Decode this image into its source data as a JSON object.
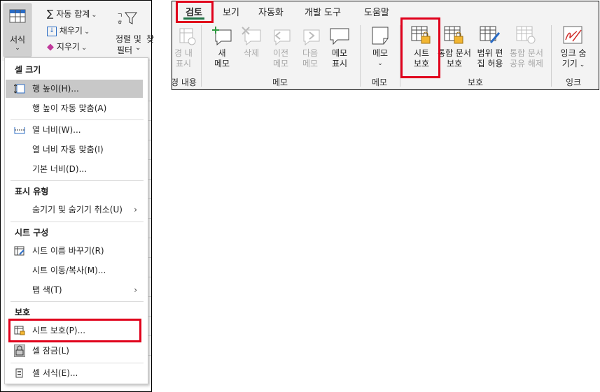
{
  "left_ribbon": {
    "format_button": "서식",
    "autosum": "자동 합계",
    "fill": "채우기",
    "clear": "지우기",
    "sort_filter_line1": "정렬 및",
    "sort_filter_line2": "필터",
    "find_fragment": "찾"
  },
  "format_menu": {
    "sections": {
      "cell_size": "셀 크기",
      "visibility": "표시 유형",
      "organize_sheets": "시트 구성",
      "protection": "보호"
    },
    "items": {
      "row_height": "행 높이(H)...",
      "autofit_row": "행 높이 자동 맞춤(A)",
      "col_width": "열 너비(W)...",
      "autofit_col": "열 너비 자동 맞춤(I)",
      "default_width": "기본 너비(D)...",
      "hide_unhide": "숨기기 및 숨기기 취소(U)",
      "rename_sheet": "시트 이름 바꾸기(R)",
      "move_copy": "시트 이동/복사(M)...",
      "tab_color": "탭 색(T)",
      "protect_sheet": "시트 보호(P)...",
      "lock_cell": "셀 잠금(L)",
      "format_cells": "셀 서식(E)..."
    }
  },
  "review_ribbon": {
    "tabs": [
      "검토",
      "보기",
      "자동화",
      "개발 도구",
      "도움말"
    ],
    "buttons": {
      "show_changes_1": "경 내",
      "show_changes_2": "표시",
      "new_note_1": "새",
      "new_note_2": "메모",
      "delete": "삭제",
      "prev_1": "이전",
      "prev_2": "메모",
      "next_1": "다음",
      "next_2": "메모",
      "show_notes_1": "메모",
      "show_notes_2": "표시",
      "notes": "메모",
      "protect_sheet_1": "시트",
      "protect_sheet_2": "보호",
      "protect_wb_1": "통합 문서",
      "protect_wb_2": "보호",
      "allow_ranges_1": "범위 편",
      "allow_ranges_2": "집 허용",
      "unshare_1": "통합 문서",
      "unshare_2": "공유 해제",
      "hide_ink_1": "잉크 숨",
      "hide_ink_2": "기기"
    },
    "groups": {
      "changes": "경 내용",
      "notes": "메모",
      "notes2": "메모",
      "protect": "보호",
      "ink": "잉크"
    }
  },
  "colors": {
    "highlight_red": "#e0001b",
    "tab_underline": "#217346",
    "ribbon_bg": "#f3f3f3"
  }
}
